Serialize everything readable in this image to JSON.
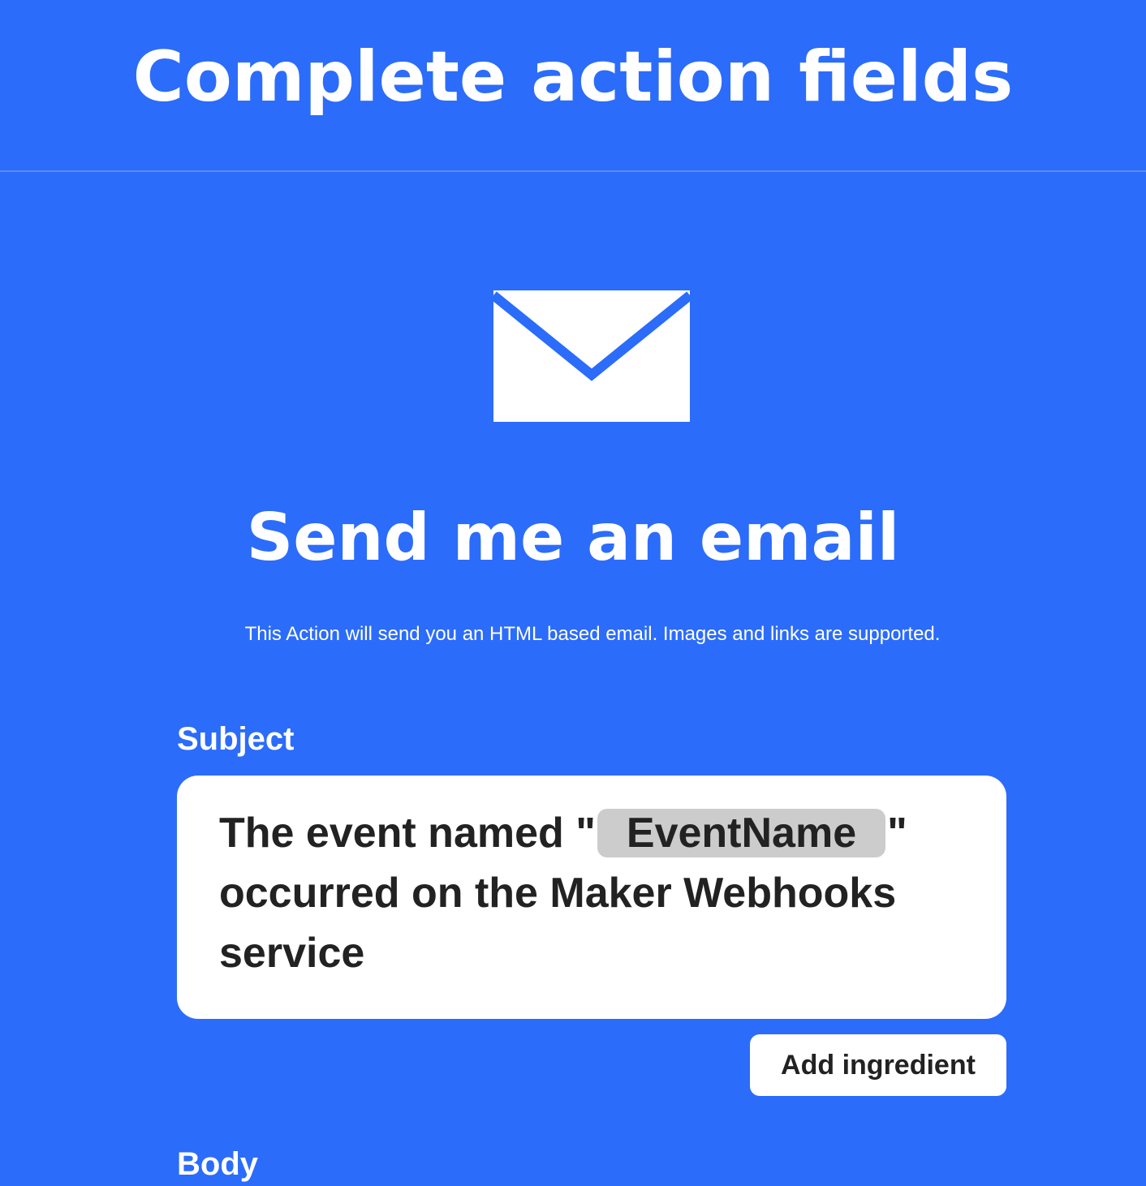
{
  "header": {
    "title": "Complete action fields"
  },
  "action": {
    "icon": "email-envelope-icon",
    "title": "Send me an email",
    "description": "This Action will send you an HTML based email. Images and links are supported."
  },
  "fields": {
    "subject": {
      "label": "Subject",
      "text_before": "The event named \"",
      "ingredient": "EventName",
      "text_after": "\" occurred on the Maker Webhooks service"
    },
    "add_ingredient_label": "Add ingredient",
    "next_label_partial": "Body"
  },
  "colors": {
    "background": "#2b6cfa",
    "field_background": "#ffffff",
    "ingredient_pill": "#cccccc",
    "text_dark": "#222222"
  }
}
